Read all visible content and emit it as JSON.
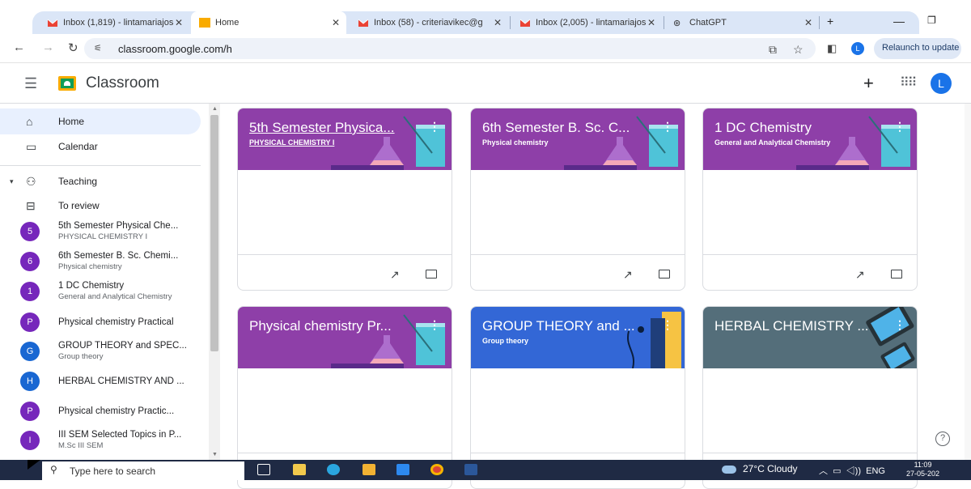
{
  "browser": {
    "tabs": [
      {
        "label": "Inbox (1,819) - lintamariajos",
        "icon": "gmail-icon"
      },
      {
        "label": "Home",
        "icon": "classroom-icon",
        "active": true
      },
      {
        "label": "Inbox (58) - criteriavikec@g",
        "icon": "gmail-icon"
      },
      {
        "label": "Inbox (2,005) - lintamariajos",
        "icon": "gmail-icon"
      },
      {
        "label": "ChatGPT",
        "icon": "chatgpt-icon"
      }
    ],
    "url": "classroom.google.com/h",
    "relaunch_label": "Relaunch to update",
    "profile_initial": "L"
  },
  "app": {
    "title": "Classroom",
    "avatar_initial": "L",
    "accent": "#1a73e8"
  },
  "sidebar": {
    "home": "Home",
    "calendar": "Calendar",
    "teaching": "Teaching",
    "to_review": "To review",
    "classes": [
      {
        "initial": "5",
        "title": "5th Semester Physical Che...",
        "sub": "PHYSICAL CHEMISTRY I",
        "color": "#7627bb"
      },
      {
        "initial": "6",
        "title": "6th Semester B. Sc. Chemi...",
        "sub": "Physical chemistry",
        "color": "#7627bb"
      },
      {
        "initial": "1",
        "title": "1 DC Chemistry",
        "sub": "General and Analytical Chemistry",
        "color": "#7627bb"
      },
      {
        "initial": "P",
        "title": "Physical chemistry Practical",
        "sub": "",
        "color": "#7627bb"
      },
      {
        "initial": "G",
        "title": "GROUP THEORY and SPEC...",
        "sub": "Group theory",
        "color": "#1967d2"
      },
      {
        "initial": "H",
        "title": "HERBAL CHEMISTRY AND ...",
        "sub": "",
        "color": "#1967d2"
      },
      {
        "initial": "P",
        "title": "Physical chemistry Practic...",
        "sub": "",
        "color": "#7627bb"
      },
      {
        "initial": "I",
        "title": "III SEM Selected Topics in P...",
        "sub": "M.Sc III SEM",
        "color": "#7627bb"
      }
    ]
  },
  "cards": [
    {
      "title": "5th Semester Physica...",
      "sub": "PHYSICAL CHEMISTRY I",
      "color": "#8e3fa8",
      "theme": "flask"
    },
    {
      "title": "6th Semester B. Sc. C...",
      "sub": "Physical chemistry",
      "color": "#8e3fa8",
      "theme": "flask"
    },
    {
      "title": "1 DC Chemistry",
      "sub": "General and Analytical Chemistry",
      "color": "#8e3fa8",
      "theme": "flask"
    },
    {
      "title": "Physical chemistry Pr...",
      "sub": "",
      "color": "#8e3fa8",
      "theme": "flask"
    },
    {
      "title": "GROUP THEORY and ...",
      "sub": "Group theory",
      "color": "#3367d6",
      "theme": "books"
    },
    {
      "title": "HERBAL CHEMISTRY ...",
      "sub": "",
      "color": "#546e7a",
      "theme": "devices"
    }
  ],
  "taskbar": {
    "search_placeholder": "Type here to search",
    "weather": "27°C  Cloudy",
    "lang": "ENG",
    "time": "11:09",
    "date": "27-05-202"
  }
}
